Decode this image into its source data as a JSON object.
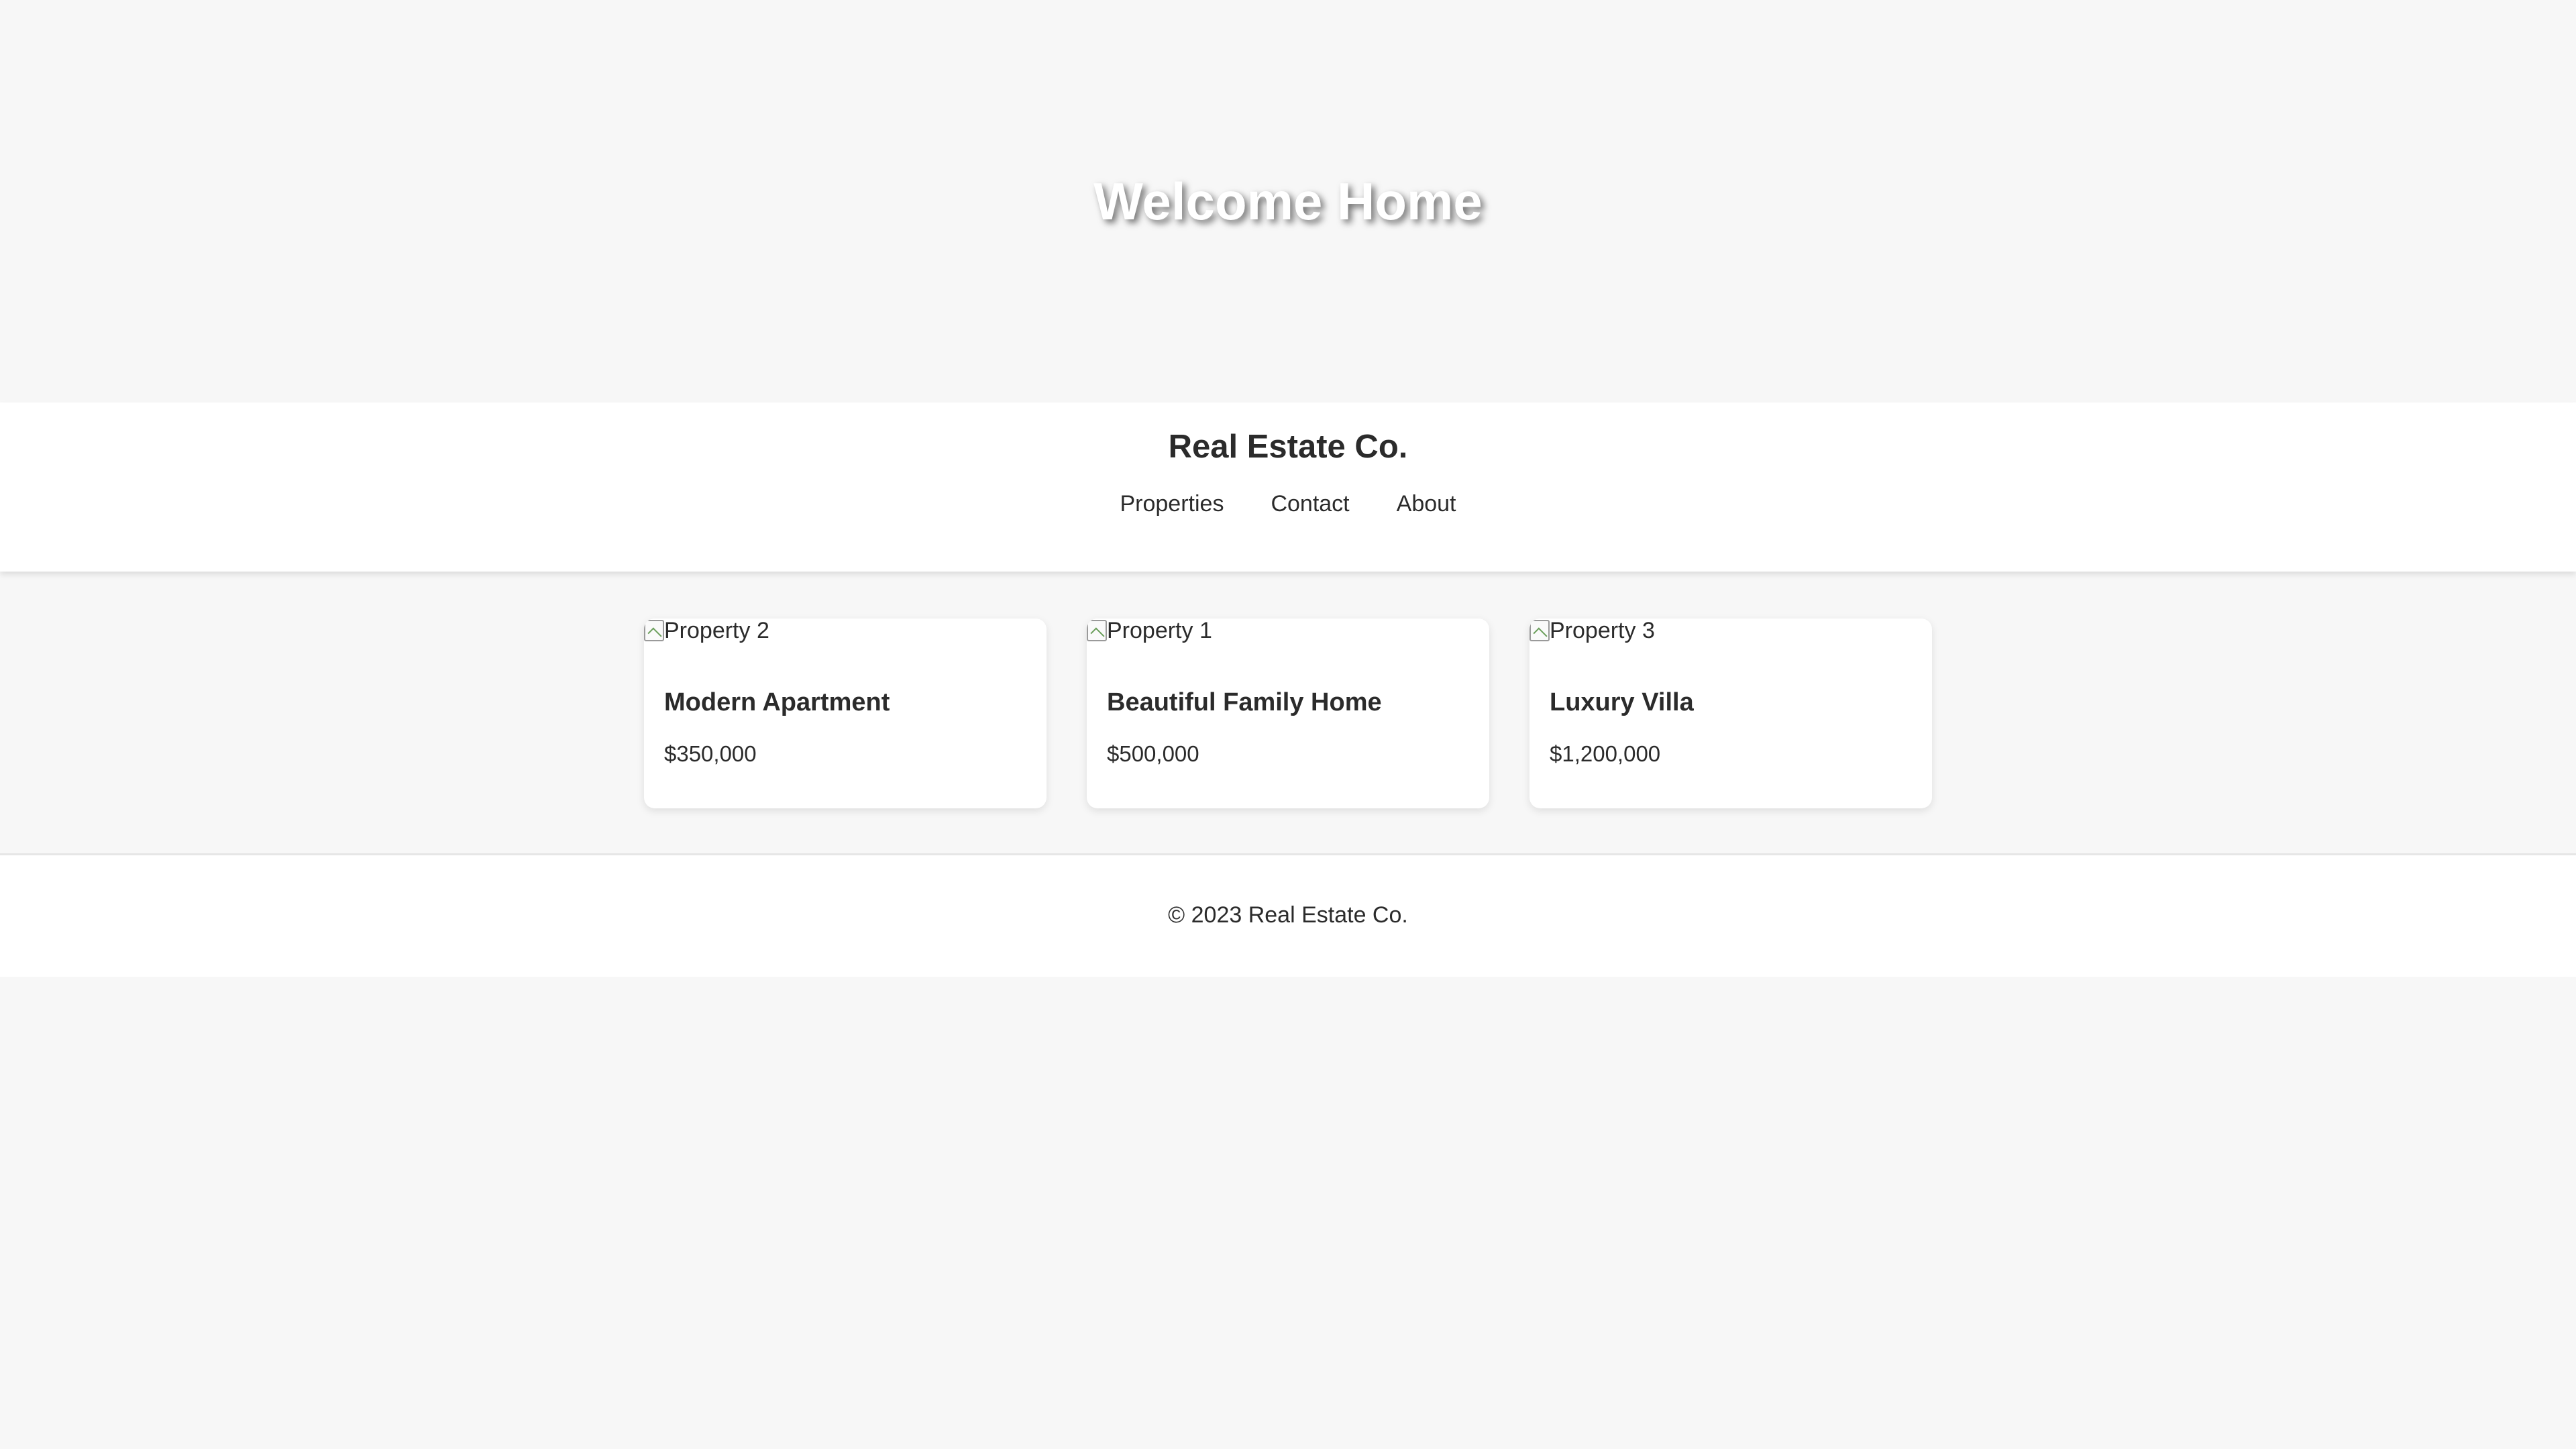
{
  "hero": {
    "title": "Welcome Home"
  },
  "header": {
    "brand": "Real Estate Co.",
    "nav": [
      {
        "label": "Properties"
      },
      {
        "label": "Contact"
      },
      {
        "label": "About"
      }
    ]
  },
  "properties": [
    {
      "image_alt": "Property 2",
      "title": "Modern Apartment",
      "price": "$350,000",
      "image_icon": "broken-image-icon"
    },
    {
      "image_alt": "Property 1",
      "title": "Beautiful Family Home",
      "price": "$500,000",
      "image_icon": "broken-image-icon"
    },
    {
      "image_alt": "Property 3",
      "title": "Luxury Villa",
      "price": "$1,200,000",
      "image_icon": "broken-image-icon"
    }
  ],
  "footer": {
    "text": "© 2023 Real Estate Co."
  },
  "colors": {
    "background": "#f7f7f7",
    "surface": "#ffffff",
    "text": "#2b2b2b"
  }
}
